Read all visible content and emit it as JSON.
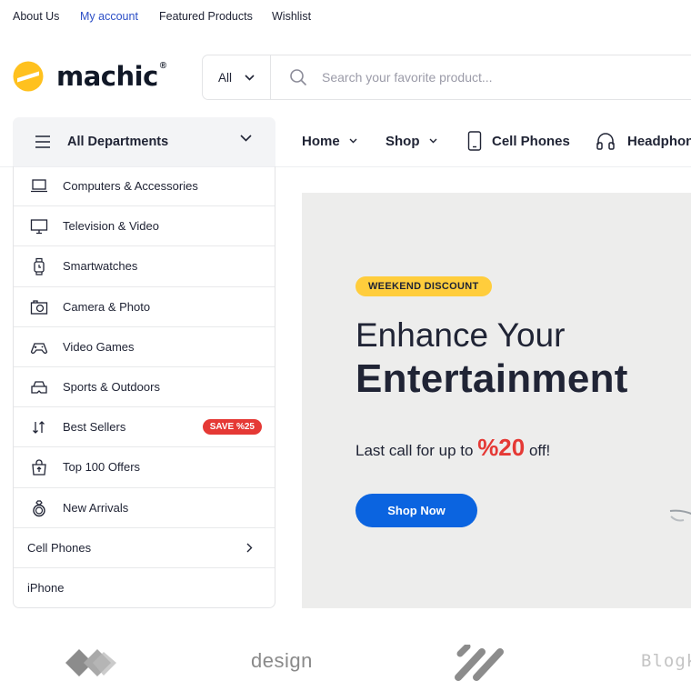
{
  "topbar": {
    "links": [
      "About Us",
      "My account",
      "Featured Products",
      "Wishlist"
    ]
  },
  "header": {
    "logo_text": "machic",
    "logo_mark": "®",
    "search_category": "All",
    "search_placeholder": "Search your favorite product..."
  },
  "nav": {
    "departments_label": "All Departments",
    "items": [
      {
        "label": "Home",
        "icon": "chevron-down-icon"
      },
      {
        "label": "Shop",
        "icon": "chevron-down-icon"
      },
      {
        "label": "Cell Phones",
        "icon": "phone-icon"
      },
      {
        "label": "Headphones",
        "icon": "headphones-icon"
      }
    ]
  },
  "departments": [
    {
      "label": "Computers & Accessories",
      "icon": "laptop-icon"
    },
    {
      "label": "Television & Video",
      "icon": "monitor-icon"
    },
    {
      "label": "Smartwatches",
      "icon": "watch-icon"
    },
    {
      "label": "Camera & Photo",
      "icon": "camera-icon"
    },
    {
      "label": "Video Games",
      "icon": "gamepad-icon"
    },
    {
      "label": "Sports & Outdoors",
      "icon": "vr-headset-icon"
    },
    {
      "label": "Best Sellers",
      "icon": "sort-arrows-icon",
      "badge": "SAVE %25"
    },
    {
      "label": "Top 100 Offers",
      "icon": "shopping-bag-icon"
    },
    {
      "label": "New Arrivals",
      "icon": "ring-icon"
    },
    {
      "label": "Cell Phones",
      "icon": "chevron-right-icon"
    },
    {
      "label": "iPhone"
    }
  ],
  "hero": {
    "badge": "WEEKEND DISCOUNT",
    "title_line1": "Enhance Your",
    "title_line2": "Entertainment",
    "sub_prefix": "Last call for up to ",
    "sub_highlight": "%20",
    "sub_suffix": " off!",
    "button": "Shop Now"
  },
  "brands": [
    "design",
    "Blogk"
  ],
  "colors": {
    "accent_blue": "#0b64e0",
    "link_blue": "#2b4ec6",
    "badge_red": "#e53935",
    "badge_yellow": "#ffcd3c",
    "logo_yellow": "#ffc11e"
  }
}
